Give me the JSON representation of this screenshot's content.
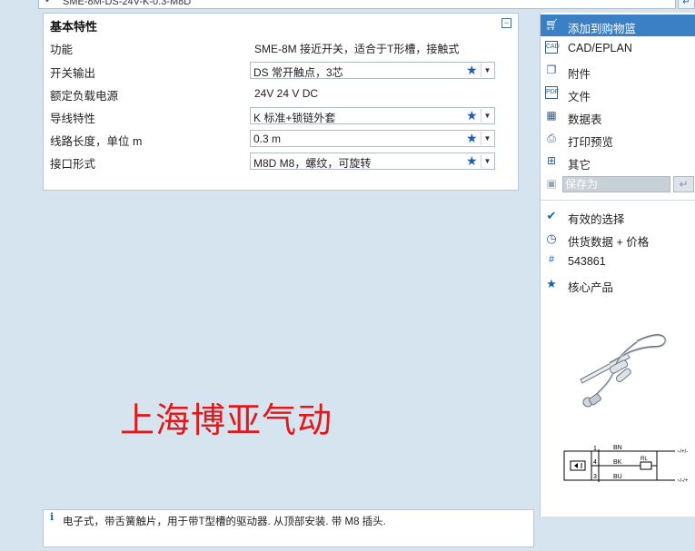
{
  "top_bar": {
    "field_text": "SME-8M-DS-24V-K-0.3-M8D",
    "corner_icon": "return-arrow-icon"
  },
  "features": {
    "title": "基本特性",
    "collapse_icon": "collapse-icon",
    "rows": [
      {
        "label": "功能",
        "value": "SME-8M 接近开关，适合于T形槽，接触式"
      },
      {
        "label": "开关输出",
        "value": "DS 常开触点，3芯"
      },
      {
        "label": "额定负载电源",
        "value": "24V 24 V DC"
      },
      {
        "label": "导线特性",
        "value": "K 标准+锁链外套"
      },
      {
        "label": "线路长度，单位 m",
        "value": "0.3 m"
      },
      {
        "label": "接口形式",
        "value": "M8D M8，螺纹，可旋转"
      }
    ]
  },
  "watermark": "上海博亚气动",
  "info": {
    "icon": "i",
    "text": "电子式，带舌簧触片，用于带T型槽的驱动器. 从顶部安装. 带 M8 插头."
  },
  "actions": [
    {
      "label": "添加到购物篮",
      "icon": "cart-icon"
    },
    {
      "label": "CAD/EPLAN",
      "icon": "cad-icon"
    },
    {
      "label": "附件",
      "icon": "attachment-icon"
    },
    {
      "label": "文件",
      "icon": "pdf-icon"
    },
    {
      "label": "数据表",
      "icon": "table-icon"
    },
    {
      "label": "打印预览",
      "icon": "printer-icon"
    },
    {
      "label": "其它",
      "icon": "plus-icon"
    }
  ],
  "save_as": {
    "placeholder": "保存为",
    "icon": "save-icon",
    "button_icon": "enter-icon"
  },
  "properties": [
    {
      "label": "有效的选择",
      "icon": "checkmark-icon"
    },
    {
      "label": "供货数据 + 价格",
      "icon": "clock-icon"
    },
    {
      "label": "543861",
      "icon": "hash-icon"
    },
    {
      "label": "核心产品",
      "icon": "star-icon"
    }
  ],
  "wiring": {
    "pins": [
      "1",
      "4",
      "3"
    ],
    "wires": [
      "BN",
      "BK",
      "BU"
    ],
    "load": "RL",
    "supply": [
      "~/+/-",
      "~/-/+"
    ]
  },
  "colors": {
    "background": "#d6e4f0",
    "accent": "#3b7fc4",
    "icon_blue": "#1a5fb4",
    "watermark": "#e0191b"
  }
}
